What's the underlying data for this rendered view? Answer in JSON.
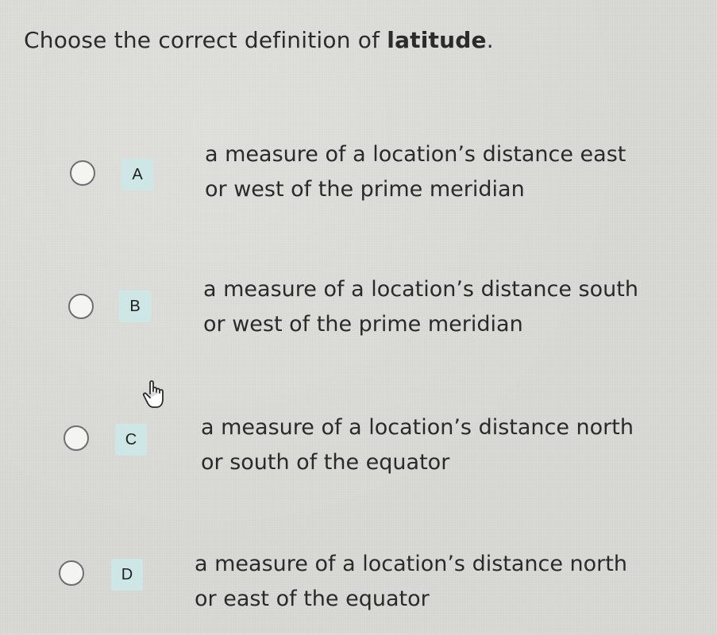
{
  "question": {
    "prefix": "Choose the correct definition of ",
    "keyword": "latitude",
    "suffix": "."
  },
  "choices": [
    {
      "letter": "A",
      "line1": "a measure of a location’s distance east",
      "line2": "or west of the prime meridian"
    },
    {
      "letter": "B",
      "line1": "a measure of a location’s distance south",
      "line2": "or west of the prime meridian"
    },
    {
      "letter": "C",
      "line1": "a measure of a location’s distance north",
      "line2": "or south of the equator"
    },
    {
      "letter": "D",
      "line1": "a measure of a location’s distance north",
      "line2": "or east of the equator"
    }
  ],
  "colors": {
    "background": "#d9dad5",
    "badge": "#cfe6e6",
    "radio_border": "#6d6e70"
  },
  "icons": {
    "cursor": "hand-pointer-icon"
  }
}
